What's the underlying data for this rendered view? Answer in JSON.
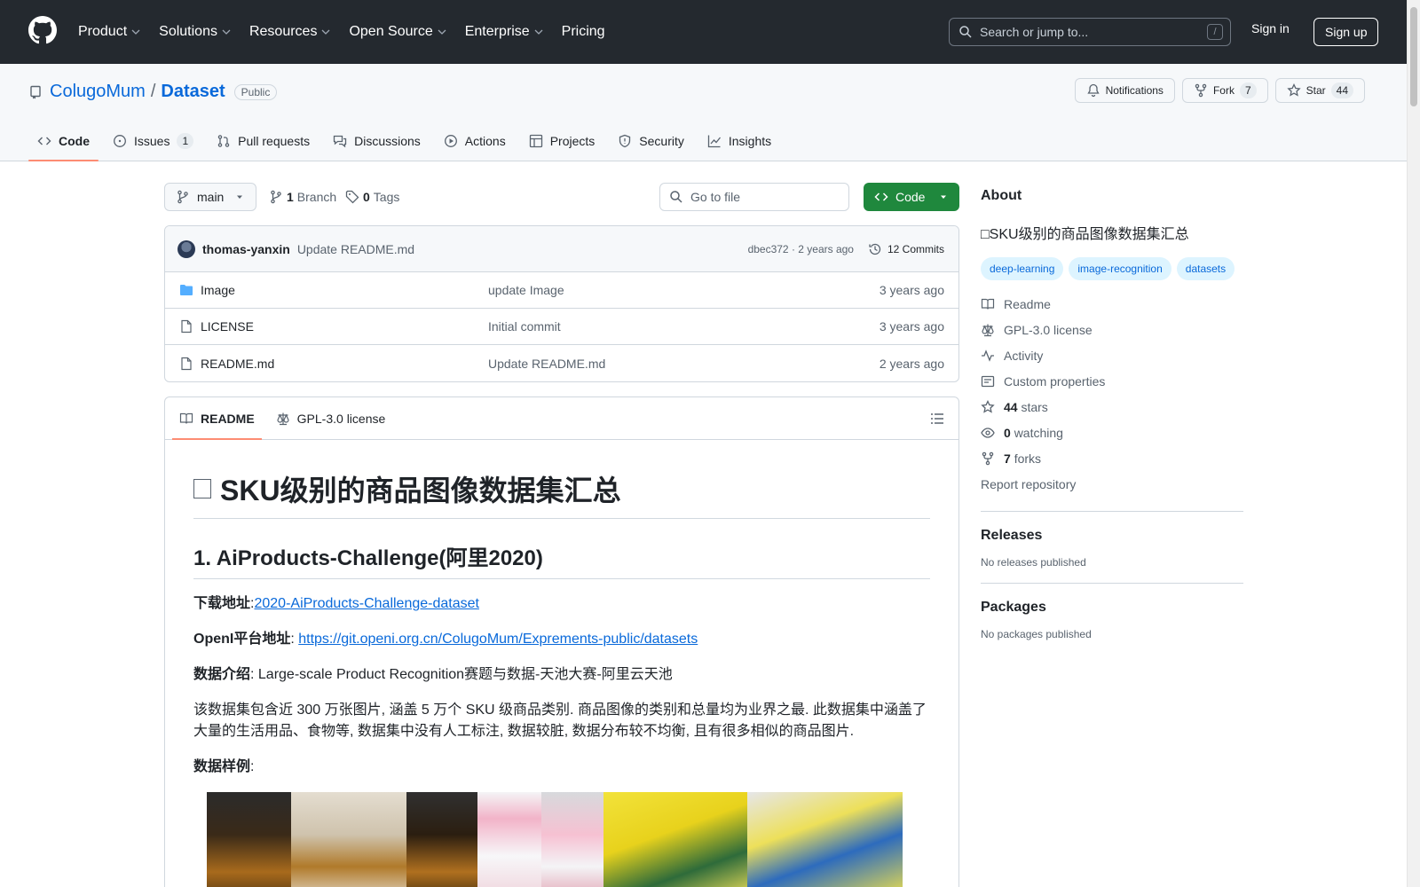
{
  "header": {
    "nav": [
      "Product",
      "Solutions",
      "Resources",
      "Open Source",
      "Enterprise",
      "Pricing"
    ],
    "search_placeholder": "Search or jump to...",
    "search_key": "/",
    "sign_in": "Sign in",
    "sign_up": "Sign up"
  },
  "repo": {
    "owner": "ColugoMum",
    "separator": "/",
    "name": "Dataset",
    "visibility": "Public",
    "notifications_label": "Notifications",
    "fork_label": "Fork",
    "fork_count": "7",
    "star_label": "Star",
    "star_count": "44"
  },
  "tabs": [
    {
      "label": "Code",
      "icon": "code-icon",
      "active": true
    },
    {
      "label": "Issues",
      "icon": "issue-icon",
      "count": "1"
    },
    {
      "label": "Pull requests",
      "icon": "pull-request-icon"
    },
    {
      "label": "Discussions",
      "icon": "discussions-icon"
    },
    {
      "label": "Actions",
      "icon": "play-icon"
    },
    {
      "label": "Projects",
      "icon": "table-icon"
    },
    {
      "label": "Security",
      "icon": "shield-icon"
    },
    {
      "label": "Insights",
      "icon": "graph-icon"
    }
  ],
  "toolbar": {
    "branch": "main",
    "branch_count": "1",
    "branch_label": "Branch",
    "tag_count": "0",
    "tag_label": "Tags",
    "goto_placeholder": "Go to file",
    "code_label": "Code"
  },
  "commit": {
    "author": "thomas-yanxin",
    "message": "Update README.md",
    "hash_time": "dbec372 · 2 years ago",
    "commits_label": "12 Commits"
  },
  "files": [
    {
      "type": "folder",
      "name": "Image",
      "message": "update Image",
      "date": "3 years ago"
    },
    {
      "type": "file",
      "name": "LICENSE",
      "message": "Initial commit",
      "date": "3 years ago"
    },
    {
      "type": "file",
      "name": "README.md",
      "message": "Update README.md",
      "date": "2 years ago"
    }
  ],
  "readme": {
    "tab_readme": "README",
    "tab_license": "GPL-3.0 license",
    "h1": "SKU级别的商品图像数据集汇总",
    "h2": "1. AiProducts-Challenge(阿里2020)",
    "download_label": "下载地址",
    "download_link": "2020-AiProducts-Challenge-dataset",
    "openi_label": "OpenI平台地址",
    "openi_link": "https://git.openi.org.cn/ColugoMum/Exprements-public/datasets",
    "intro_label": "数据介绍",
    "intro_text": ": Large-scale Product Recognition赛题与数据-天池大赛-阿里云天池",
    "description": "该数据集包含近 300 万张图片, 涵盖 5 万个 SKU 级商品类别. 商品图像的类别和总量均为业界之最. 此数据集中涵盖了大量的生活用品、食物等, 数据集中没有人工标注, 数据较脏, 数据分布较不均衡, 且有很多相似的商品图片.",
    "sample_label": "数据样例"
  },
  "about": {
    "title": "About",
    "description": "□SKU级别的商品图像数据集汇总",
    "topics": [
      "deep-learning",
      "image-recognition",
      "datasets"
    ],
    "readme": "Readme",
    "license": "GPL-3.0 license",
    "activity": "Activity",
    "custom_properties": "Custom properties",
    "stars_count": "44",
    "stars_label": "stars",
    "watching_count": "0",
    "watching_label": "watching",
    "forks_count": "7",
    "forks_label": "forks",
    "report": "Report repository"
  },
  "releases": {
    "title": "Releases",
    "empty": "No releases published"
  },
  "packages": {
    "title": "Packages",
    "empty": "No packages published"
  },
  "colors": {
    "header_bg": "#24292f",
    "link": "#0969da",
    "green": "#1f883d",
    "tab_underline": "#fd8c73"
  }
}
